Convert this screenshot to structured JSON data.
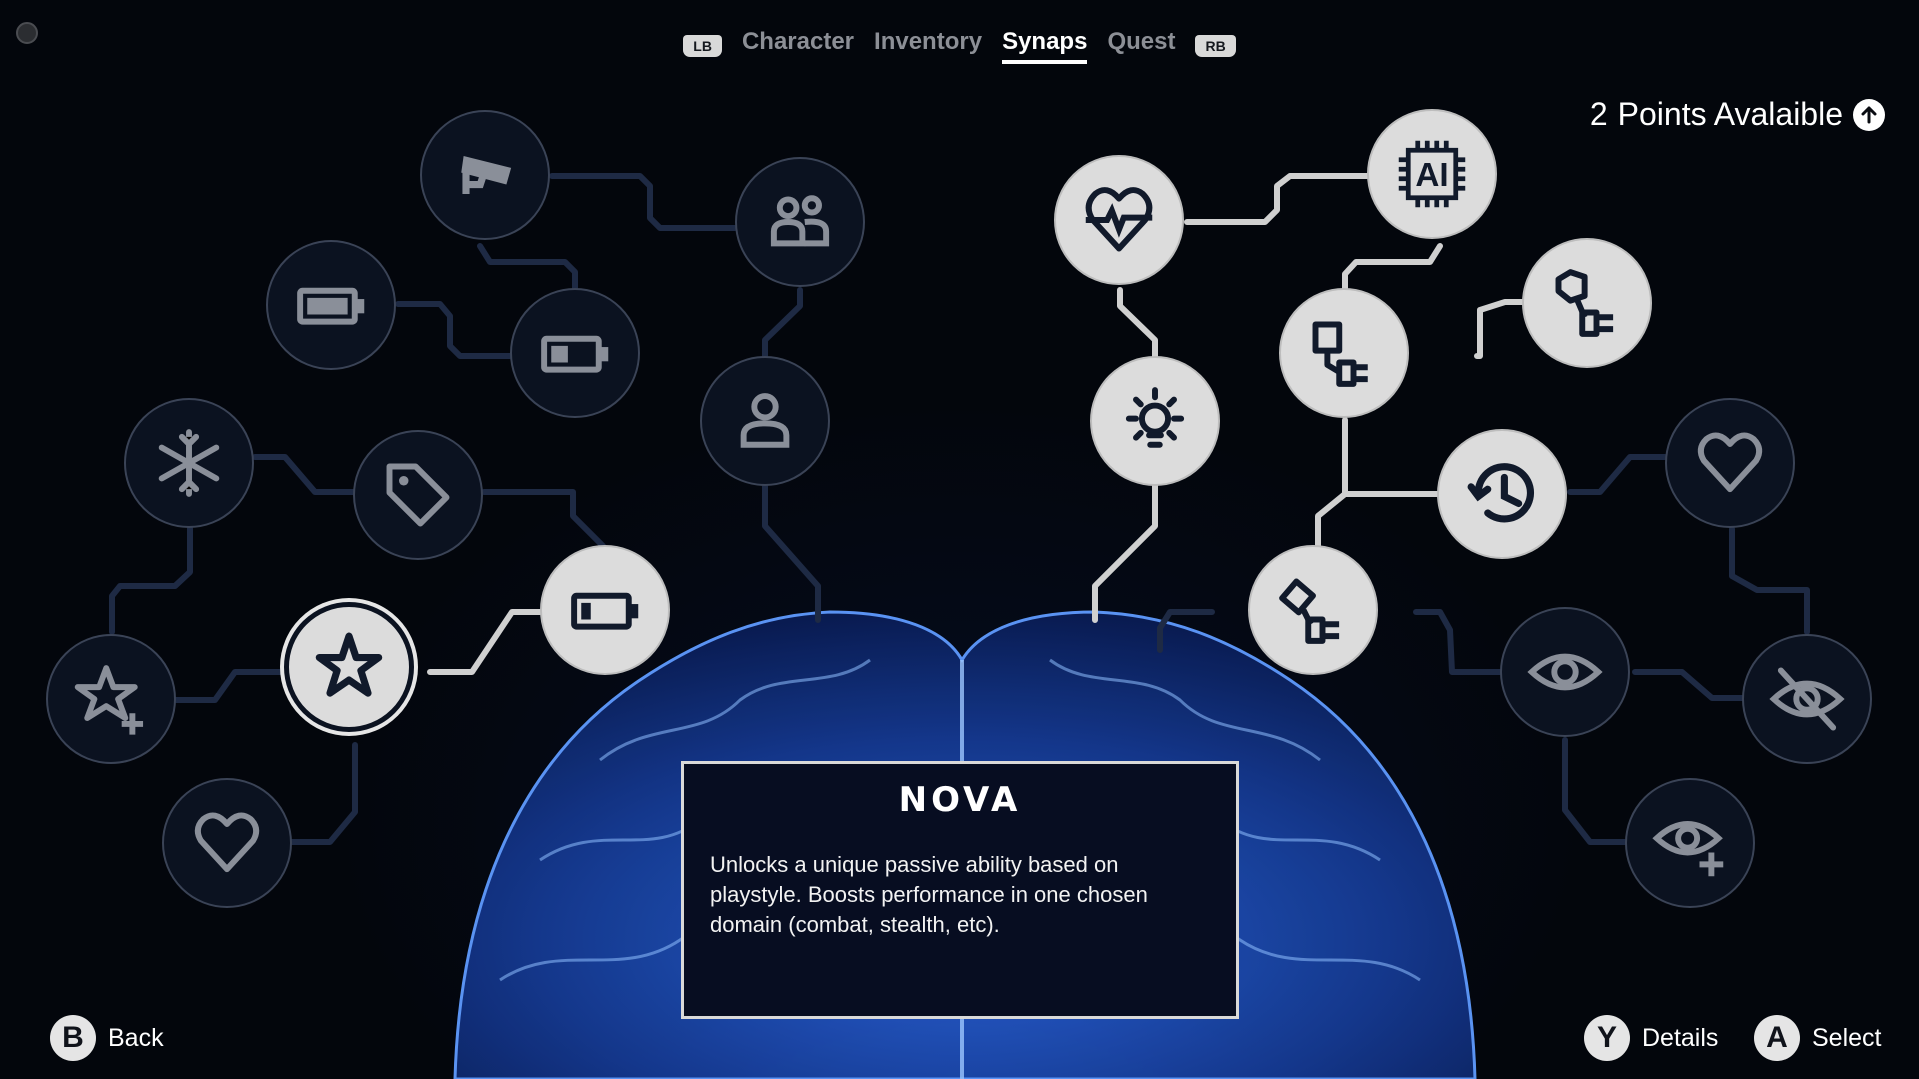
{
  "nav": {
    "left_bumper": "LB",
    "right_bumper": "RB",
    "tabs": [
      {
        "label": "Character",
        "active": false
      },
      {
        "label": "Inventory",
        "active": false
      },
      {
        "label": "Synaps",
        "active": true
      },
      {
        "label": "Quest",
        "active": false
      }
    ]
  },
  "points": {
    "count": "2",
    "label": "Points Avalaible",
    "icon": "arrow-up-icon"
  },
  "nodes": [
    {
      "id": "camera",
      "icon": "security-camera-icon",
      "state": "locked"
    },
    {
      "id": "group",
      "icon": "users-icon",
      "state": "locked"
    },
    {
      "id": "battery-full",
      "icon": "battery-full-icon",
      "state": "locked"
    },
    {
      "id": "battery-half",
      "icon": "battery-half-icon",
      "state": "locked"
    },
    {
      "id": "person",
      "icon": "user-icon",
      "state": "locked"
    },
    {
      "id": "snowflake",
      "icon": "snowflake-icon",
      "state": "locked"
    },
    {
      "id": "tag",
      "icon": "tag-icon",
      "state": "locked"
    },
    {
      "id": "battery-low",
      "icon": "battery-low-icon",
      "state": "unlocked"
    },
    {
      "id": "star-plus",
      "icon": "star-plus-icon",
      "state": "locked"
    },
    {
      "id": "nova",
      "icon": "star-icon",
      "state": "selected"
    },
    {
      "id": "heart-left",
      "icon": "heart-icon",
      "state": "locked"
    },
    {
      "id": "heartbeat",
      "icon": "heartbeat-icon",
      "state": "unlocked"
    },
    {
      "id": "ai-chip",
      "icon": "ai-chip-icon",
      "state": "unlocked"
    },
    {
      "id": "bulb",
      "icon": "lightbulb-icon",
      "state": "unlocked"
    },
    {
      "id": "plug-mid",
      "icon": "plug-icon",
      "state": "unlocked"
    },
    {
      "id": "plug-right",
      "icon": "plug-icon",
      "state": "unlocked"
    },
    {
      "id": "history",
      "icon": "history-icon",
      "state": "unlocked"
    },
    {
      "id": "heart-right",
      "icon": "heart-icon",
      "state": "locked"
    },
    {
      "id": "plug-low",
      "icon": "plug-icon",
      "state": "unlocked"
    },
    {
      "id": "eye",
      "icon": "eye-icon",
      "state": "locked"
    },
    {
      "id": "eye-off",
      "icon": "eye-off-icon",
      "state": "locked"
    },
    {
      "id": "eye-plus",
      "icon": "eye-plus-icon",
      "state": "locked"
    }
  ],
  "ai_chip_text": "AI",
  "info": {
    "title": "NOVA",
    "description": "Unlocks a unique passive ability based on playstyle. Boosts performance in one chosen domain (combat, stealth, etc)."
  },
  "footer": {
    "back": {
      "glyph": "B",
      "label": "Back"
    },
    "details": {
      "glyph": "Y",
      "label": "Details"
    },
    "select": {
      "glyph": "A",
      "label": "Select"
    }
  },
  "colors": {
    "background": "#03060c",
    "locked_node": "#0b1220",
    "unlocked_node": "#dcdcdc",
    "locked_link": "#1e2a44",
    "unlocked_link": "#d0d0d0",
    "brain_glow": "#1e5adc"
  }
}
